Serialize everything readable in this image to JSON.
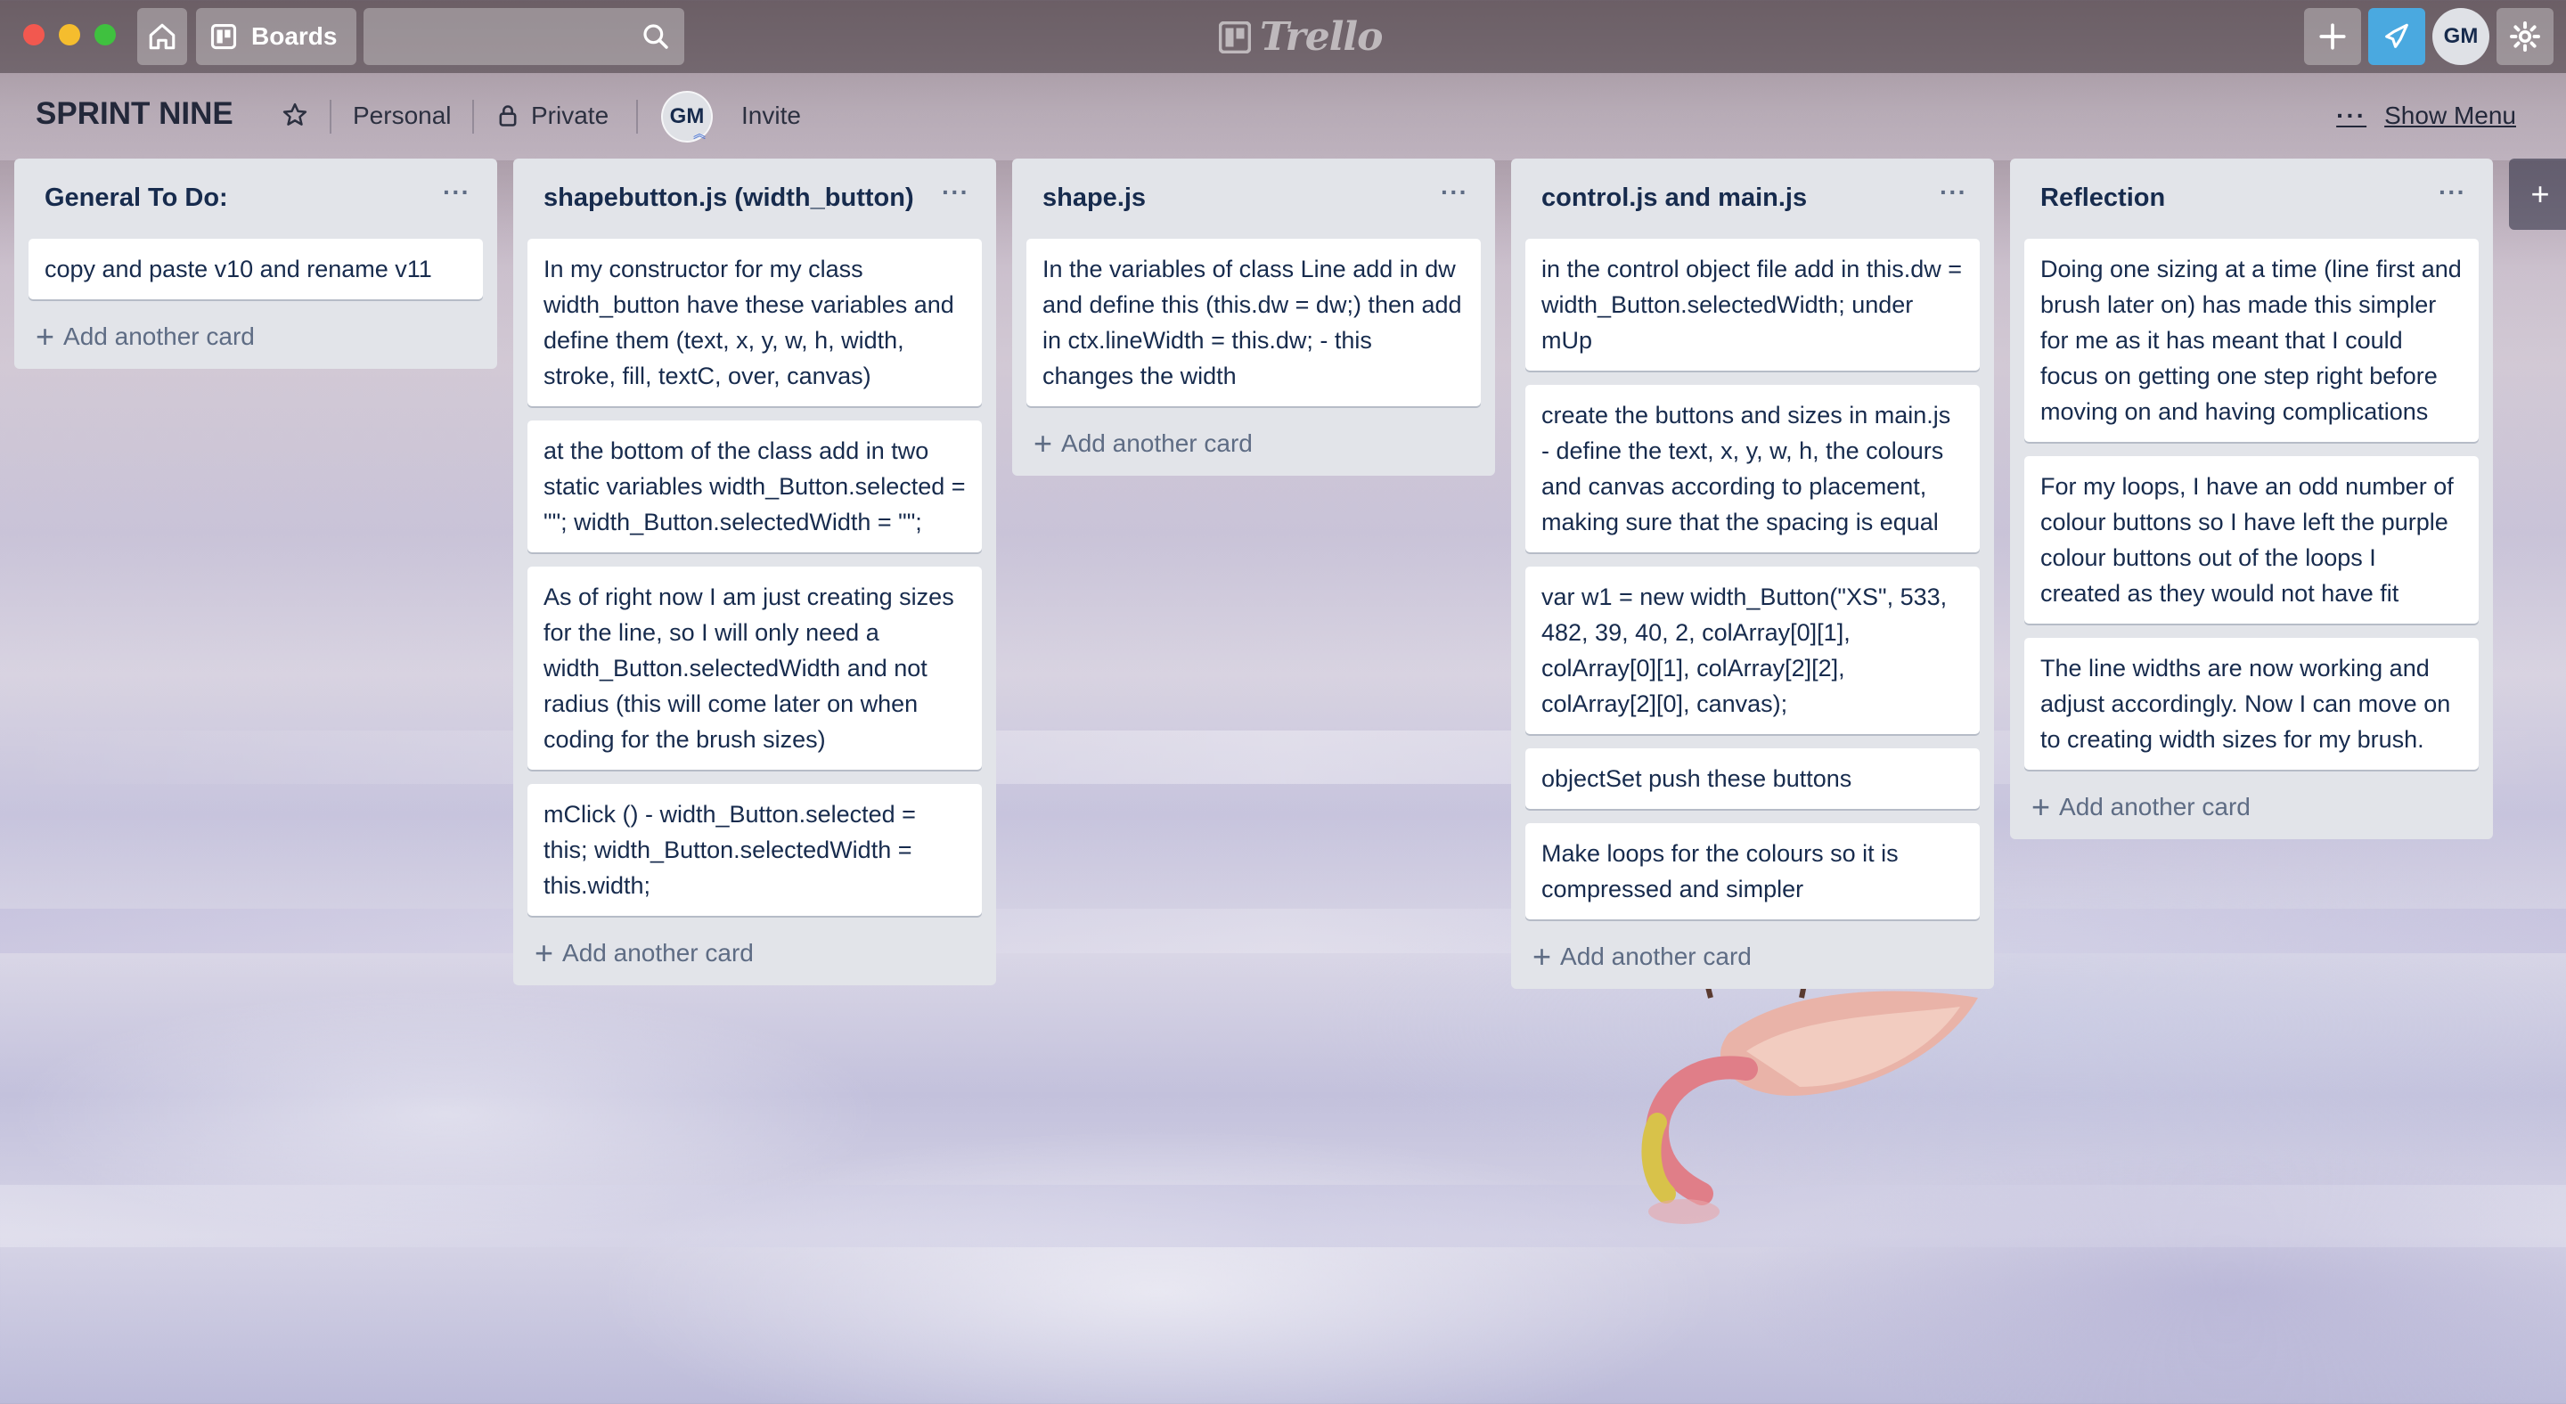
{
  "topbar": {
    "boards_label": "Boards",
    "search_placeholder": "",
    "logo_text": "Trello",
    "avatar_initials": "GM"
  },
  "board": {
    "title": "SPRINT NINE",
    "team": "Personal",
    "visibility": "Private",
    "member_initials": "GM",
    "invite_label": "Invite",
    "show_menu_label": "Show Menu"
  },
  "lists": [
    {
      "title": "General To Do:",
      "cards": [
        "copy and paste v10 and rename v11"
      ],
      "add_label": "Add another card"
    },
    {
      "title": "shapebutton.js (width_button)",
      "cards": [
        "In my constructor for my class width_button have these variables and define them (text, x, y, w, h, width, stroke, fill, textC, over, canvas)",
        "at the bottom of the class add in two static variables width_Button.selected = \"\"; width_Button.selectedWidth = \"\";",
        "As of right now I am just creating sizes for the line, so I will only need a width_Button.selectedWidth and not radius (this will come later on when coding for the brush sizes)",
        "mClick () - width_Button.selected = this; width_Button.selectedWidth = this.width;"
      ],
      "add_label": "Add another card"
    },
    {
      "title": "shape.js",
      "cards": [
        "In the variables of class Line add in dw and define this (this.dw = dw;) then add in ctx.lineWidth = this.dw; - this changes the width"
      ],
      "add_label": "Add another card"
    },
    {
      "title": "control.js and main.js",
      "cards": [
        "in the control object file add in this.dw = width_Button.selectedWidth; under mUp",
        "create the buttons and sizes in main.js - define the text, x, y, w, h, the colours and canvas according to placement, making sure that the spacing is equal",
        "var w1 = new width_Button(\"XS\", 533, 482, 39, 40, 2, colArray[0][1], colArray[0][1], colArray[2][2], colArray[2][0], canvas);",
        "objectSet push these buttons",
        "Make loops for the colours so it is compressed and simpler"
      ],
      "add_label": "Add another card"
    },
    {
      "title": "Reflection",
      "cards": [
        "Doing one sizing at a time (line first and brush later on) has made this simpler for me as it has meant that I could focus on getting one step right before moving on and having complications",
        "For my loops, I have an odd number of colour buttons so I have left the purple colour buttons out of the loops I created as they would not have fit",
        "The line widths are now working and adjust accordingly. Now I can move on to creating width sizes for my brush."
      ],
      "add_label": "Add another card"
    }
  ],
  "icons": {
    "home": "home-icon",
    "boards": "boards-icon",
    "search": "search-icon",
    "add": "plus-icon",
    "notification": "megaphone-icon",
    "settings": "gear-icon",
    "star": "star-icon",
    "lock": "lock-icon",
    "more": "ellipsis-icon"
  },
  "colors": {
    "list_bg": "#e2e4e9",
    "card_bg": "#ffffff",
    "text_primary": "#172b4d",
    "text_muted": "#5e6c84",
    "notify_accent": "#4aa9e0"
  }
}
